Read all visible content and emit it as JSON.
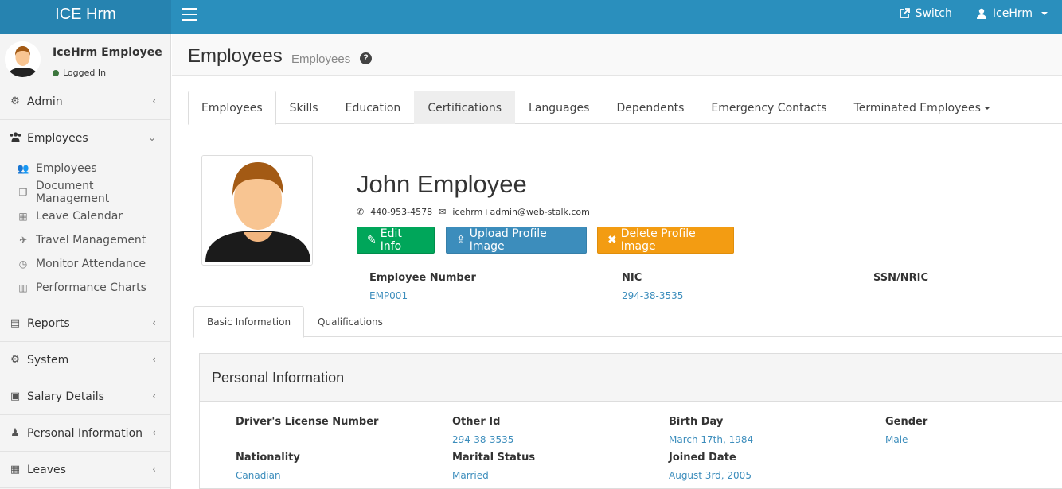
{
  "app": {
    "title": "ICE Hrm"
  },
  "topbar": {
    "switch_label": "Switch",
    "user_label": "IceHrm"
  },
  "sidebar": {
    "user_name": "IceHrm Employee",
    "status": "Logged In",
    "items": [
      {
        "label": "Admin",
        "icon": "cogs-icon"
      },
      {
        "label": "Employees",
        "icon": "users-icon"
      },
      {
        "label": "Reports",
        "icon": "file-icon"
      },
      {
        "label": "System",
        "icon": "cogs-icon"
      },
      {
        "label": "Salary Details",
        "icon": "money-icon"
      },
      {
        "label": "Personal Information",
        "icon": "male-icon"
      },
      {
        "label": "Leaves",
        "icon": "calendar-icon"
      }
    ],
    "employees_sub": [
      {
        "label": "Employees",
        "icon": "users-icon"
      },
      {
        "label": "Document Management",
        "icon": "files-icon"
      },
      {
        "label": "Leave Calendar",
        "icon": "calendar-icon"
      },
      {
        "label": "Travel Management",
        "icon": "plane-icon"
      },
      {
        "label": "Monitor Attendance",
        "icon": "clock-icon"
      },
      {
        "label": "Performance Charts",
        "icon": "bar-chart-icon"
      }
    ]
  },
  "header": {
    "title": "Employees",
    "subtitle": "Employees"
  },
  "tabs": [
    {
      "label": "Employees"
    },
    {
      "label": "Skills"
    },
    {
      "label": "Education"
    },
    {
      "label": "Certifications"
    },
    {
      "label": "Languages"
    },
    {
      "label": "Dependents"
    },
    {
      "label": "Emergency Contacts"
    },
    {
      "label": "Terminated Employees"
    }
  ],
  "profile": {
    "name": "John Employee",
    "phone": "440-953-4578",
    "email": "icehrm+admin@web-stalk.com",
    "buttons": {
      "edit": "Edit Info",
      "upload": "Upload Profile Image",
      "delete": "Delete Profile Image"
    },
    "summary": [
      {
        "label": "Employee Number",
        "value": "EMP001"
      },
      {
        "label": "NIC",
        "value": "294-38-3535"
      },
      {
        "label": "SSN/NRIC",
        "value": ""
      }
    ]
  },
  "subtabs": [
    {
      "label": "Basic Information"
    },
    {
      "label": "Qualifications"
    }
  ],
  "personal": {
    "title": "Personal Information",
    "fields": [
      {
        "label": "Driver's License Number",
        "value": ""
      },
      {
        "label": "Other Id",
        "value": "294-38-3535"
      },
      {
        "label": "Birth Day",
        "value": "March 17th, 1984"
      },
      {
        "label": "Gender",
        "value": "Male"
      },
      {
        "label": "Nationality",
        "value": "Canadian"
      },
      {
        "label": "Marital Status",
        "value": "Married"
      },
      {
        "label": "Joined Date",
        "value": "August 3rd, 2005"
      }
    ]
  }
}
